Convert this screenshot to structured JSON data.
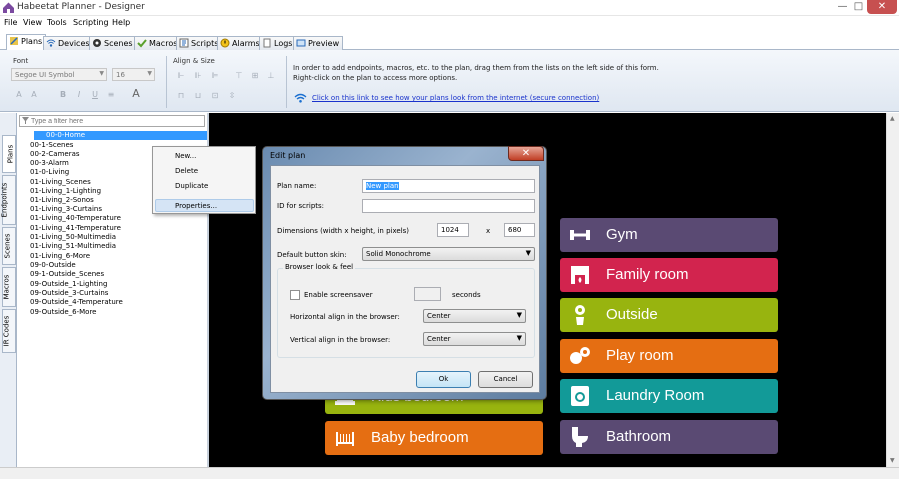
{
  "window": {
    "title": "Habeetat Planner - Designer",
    "close": "✕",
    "min": "—",
    "max": "□"
  },
  "menu": [
    "File",
    "View",
    "Tools",
    "Scripting",
    "Help"
  ],
  "tabs": [
    {
      "label": "Plans",
      "icon": "plans-icon"
    },
    {
      "label": "Devices",
      "icon": "devices-icon"
    },
    {
      "label": "Scenes",
      "icon": "scenes-icon"
    },
    {
      "label": "Macros",
      "icon": "macros-icon"
    },
    {
      "label": "Scripts",
      "icon": "scripts-icon"
    },
    {
      "label": "Alarms",
      "icon": "alarms-icon"
    },
    {
      "label": "Logs",
      "icon": "logs-icon"
    },
    {
      "label": "Preview",
      "icon": "preview-icon"
    }
  ],
  "ribbon": {
    "font_group": "Font",
    "align_group": "Align & Size",
    "font_name": "Segoe UI Symbol",
    "font_size": "16",
    "info_line1": "In order to add endpoints, macros, etc. to the plan, drag them from the lists on the left side of this form.",
    "info_line2": "Right-click on the plan to access more options.",
    "link": "Click on this link to see how your plans look from the internet (secure connection)"
  },
  "side_tabs": [
    "Plans",
    "Endpoints",
    "Scenes",
    "Macros",
    "IR Codes"
  ],
  "filter_placeholder": "Type a filter here",
  "plans": [
    "00-0-Home",
    "00-1-Scenes",
    "00-2-Cameras",
    "00-3-Alarm",
    "01-0-Living",
    "01-Living_Scenes",
    "01-Living_1-Lighting",
    "01-Living_2-Sonos",
    "01-Living_3-Curtains",
    "01-Living_40-Temperature",
    "01-Living_41-Temperature",
    "01-Living_50-Multimedia",
    "01-Living_51-Multimedia",
    "01-Living_6-More",
    "09-0-Outside",
    "09-1-Outside_Scenes",
    "09-Outside_1-Lighting",
    "09-Outside_3-Curtains",
    "09-Outside_4-Temperature",
    "09-Outside_6-More"
  ],
  "context_menu": [
    "New...",
    "Delete",
    "Duplicate",
    "Properties..."
  ],
  "tiles": [
    {
      "label": "Gym",
      "color": "#5a4a73",
      "icon": "dumbbell-icon"
    },
    {
      "label": "Family room",
      "color": "#d2244e",
      "icon": "fireplace-icon"
    },
    {
      "label": "Outside",
      "color": "#98b40f",
      "icon": "flower-icon"
    },
    {
      "label": "Play room",
      "color": "#e56e12",
      "icon": "toys-icon"
    },
    {
      "label": "Laundry Room",
      "color": "#129a98",
      "icon": "washer-icon"
    },
    {
      "label": "Bathroom",
      "color": "#5a4a73",
      "icon": "toilet-icon"
    },
    {
      "label": "Baby bedroom",
      "color": "#e56e12",
      "icon": "crib-icon"
    },
    {
      "label": "Kids bedroom",
      "color": "#98b40f",
      "icon": "bed-icon"
    }
  ],
  "dialog": {
    "title": "Edit plan",
    "plan_name_label": "Plan name:",
    "plan_name": "New plan",
    "id_label": "ID for scripts:",
    "id_value": "",
    "dims_label": "Dimensions (width x height, in pixels)",
    "width": "1024",
    "x": "x",
    "height": "680",
    "skin_label": "Default button skin:",
    "skin": "Solid Monochrome",
    "browser_group": "Browser look & feel",
    "screensaver_label": "Enable screensaver",
    "seconds_label": "seconds",
    "h_align_label": "Horizontal align in the browser:",
    "h_align": "Center",
    "v_align_label": "Vertical align in the browser:",
    "v_align": "Center",
    "ok": "Ok",
    "cancel": "Cancel"
  }
}
